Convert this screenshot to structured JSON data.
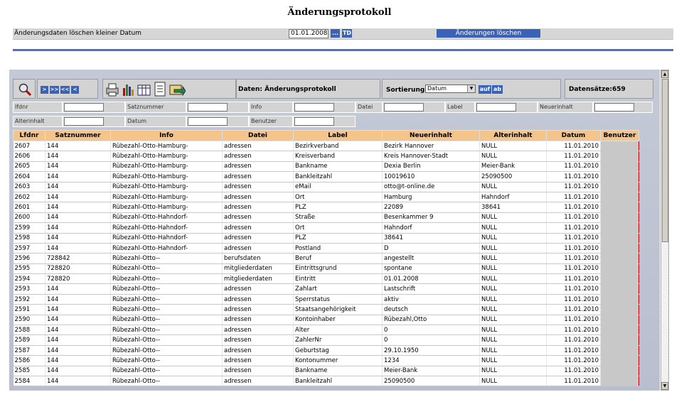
{
  "title": "Änderungsprotokoll",
  "topbar": {
    "label": "Änderungsdaten löschen kleiner Datum",
    "date_value": "01.01.2008",
    "dots_label": "...",
    "td_label": "TD",
    "delete_label": "Änderungen löschen"
  },
  "toolbar": {
    "nav": [
      ">",
      ">>",
      "<<",
      "<"
    ],
    "daten_label": "Daten: Änderungsprotokoll",
    "sort_label": "Sortierung",
    "sort_value": "Datum",
    "asc_label": "auf",
    "desc_label": "ab",
    "count_label": "Datensätze:659"
  },
  "filters": {
    "lfdnr": "lfdnr",
    "satznummer": "Satznummer",
    "info": "Info",
    "datei": "Datei",
    "label": "Label",
    "neuerinhalt": "Neuerinhalt",
    "alterinhalt": "Alterinhalt",
    "datum": "Datum",
    "benutzer": "Benutzer"
  },
  "table": {
    "headers": [
      "Lfdnr",
      "Satznummer",
      "Info",
      "Datei",
      "Label",
      "Neuerinhalt",
      "Alterinhalt",
      "Datum",
      "Benutzer"
    ],
    "rows": [
      [
        "2607",
        "144",
        "Rübezahl-Otto-Hamburg-",
        "adressen",
        "Bezirkverband",
        "Bezirk Hannover",
        "NULL",
        "11.01.2010",
        ""
      ],
      [
        "2606",
        "144",
        "Rübezahl-Otto-Hamburg-",
        "adressen",
        "Kreisverband",
        "Kreis Hannover-Stadt",
        "NULL",
        "11.01.2010",
        ""
      ],
      [
        "2605",
        "144",
        "Rübezahl-Otto-Hamburg-",
        "adressen",
        "Bankname",
        "Dexia Berlin",
        "Meier-Bank",
        "11.01.2010",
        ""
      ],
      [
        "2604",
        "144",
        "Rübezahl-Otto-Hamburg-",
        "adressen",
        "Bankleitzahl",
        "10019610",
        "25090500",
        "11.01.2010",
        ""
      ],
      [
        "2603",
        "144",
        "Rübezahl-Otto-Hamburg-",
        "adressen",
        "eMail",
        "otto@t-online.de",
        "NULL",
        "11.01.2010",
        ""
      ],
      [
        "2602",
        "144",
        "Rübezahl-Otto-Hamburg-",
        "adressen",
        "Ort",
        "Hamburg",
        "Hahndorf",
        "11.01.2010",
        ""
      ],
      [
        "2601",
        "144",
        "Rübezahl-Otto-Hamburg-",
        "adressen",
        "PLZ",
        "22089",
        "38641",
        "11.01.2010",
        ""
      ],
      [
        "2600",
        "144",
        "Rübezahl-Otto-Hahndorf-",
        "adressen",
        "Straße",
        "Besenkammer 9",
        "NULL",
        "11.01.2010",
        ""
      ],
      [
        "2599",
        "144",
        "Rübezahl-Otto-Hahndorf-",
        "adressen",
        "Ort",
        "Hahndorf",
        "NULL",
        "11.01.2010",
        ""
      ],
      [
        "2598",
        "144",
        "Rübezahl-Otto-Hahndorf-",
        "adressen",
        "PLZ",
        "38641",
        "NULL",
        "11.01.2010",
        ""
      ],
      [
        "2597",
        "144",
        "Rübezahl-Otto-Hahndorf-",
        "adressen",
        "Postland",
        "D",
        "NULL",
        "11.01.2010",
        ""
      ],
      [
        "2596",
        "728842",
        "Rübezahl-Otto--",
        "berufsdaten",
        "Beruf",
        "angestellt",
        "NULL",
        "11.01.2010",
        ""
      ],
      [
        "2595",
        "728820",
        "Rübezahl-Otto--",
        "mitgliederdaten",
        "Eintrittsgrund",
        "spontane",
        "NULL",
        "11.01.2010",
        ""
      ],
      [
        "2594",
        "728820",
        "Rübezahl-Otto--",
        "mitgliederdaten",
        "Eintritt",
        "01.01.2008",
        "NULL",
        "11.01.2010",
        ""
      ],
      [
        "2593",
        "144",
        "Rübezahl-Otto--",
        "adressen",
        "Zahlart",
        "Lastschrift",
        "NULL",
        "11.01.2010",
        ""
      ],
      [
        "2592",
        "144",
        "Rübezahl-Otto--",
        "adressen",
        "Sperrstatus",
        "aktiv",
        "NULL",
        "11.01.2010",
        ""
      ],
      [
        "2591",
        "144",
        "Rübezahl-Otto--",
        "adressen",
        "Staatsangehörigkeit",
        "deutsch",
        "NULL",
        "11.01.2010",
        ""
      ],
      [
        "2590",
        "144",
        "Rübezahl-Otto--",
        "adressen",
        "Kontoinhaber",
        "Rübezahl,Otto",
        "NULL",
        "11.01.2010",
        ""
      ],
      [
        "2588",
        "144",
        "Rübezahl-Otto--",
        "adressen",
        "Alter",
        "0",
        "NULL",
        "11.01.2010",
        ""
      ],
      [
        "2589",
        "144",
        "Rübezahl-Otto--",
        "adressen",
        "ZahlerNr",
        "0",
        "NULL",
        "11.01.2010",
        ""
      ],
      [
        "2587",
        "144",
        "Rübezahl-Otto--",
        "adressen",
        "Geburtstag",
        "29.10.1950",
        "NULL",
        "11.01.2010",
        ""
      ],
      [
        "2586",
        "144",
        "Rübezahl-Otto--",
        "adressen",
        "Kontonummer",
        "1234",
        "NULL",
        "11.01.2010",
        ""
      ],
      [
        "2585",
        "144",
        "Rübezahl-Otto--",
        "adressen",
        "Bankname",
        "Meier-Bank",
        "NULL",
        "11.01.2010",
        ""
      ],
      [
        "2584",
        "144",
        "Rübezahl-Otto--",
        "adressen",
        "Bankleitzahl",
        "25090500",
        "NULL",
        "11.01.2010",
        ""
      ]
    ]
  }
}
